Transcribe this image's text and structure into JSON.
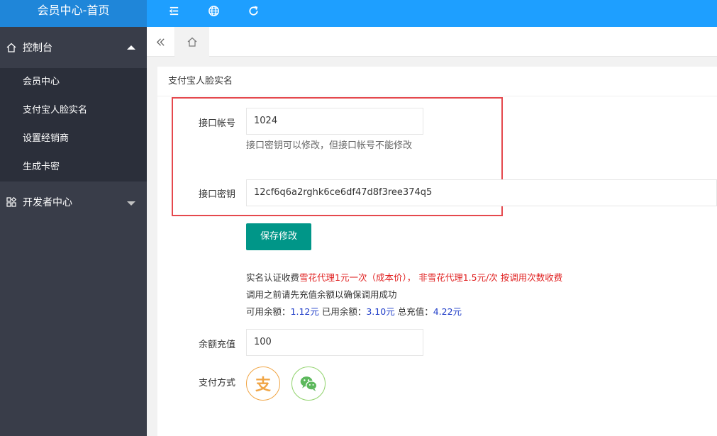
{
  "header": {
    "title": "会员中心-首页",
    "icons": [
      "menu-collapse-icon",
      "globe-icon",
      "refresh-icon"
    ]
  },
  "sidebar": {
    "console": {
      "label": "控制台",
      "icon": "home-outline-icon",
      "expanded": true
    },
    "items": [
      {
        "label": "会员中心"
      },
      {
        "label": "支付宝人脸实名"
      },
      {
        "label": "设置经销商"
      },
      {
        "label": "生成卡密"
      }
    ],
    "developer": {
      "label": "开发者中心",
      "icon": "apps-icon",
      "expanded": false
    }
  },
  "tabbar": {
    "icons": [
      "double-chevron-left-icon",
      "home-icon"
    ]
  },
  "card": {
    "title": "支付宝人脸实名",
    "account_label": "接口帐号",
    "account_value": "1024",
    "account_hint": "接口密钥可以修改，但接口帐号不能修改",
    "key_label": "接口密钥",
    "key_value": "12cf6q6a2rghk6ce6df47d8f3ree374q5",
    "save_label": "保存修改",
    "fee_prefix": "实名认证收费",
    "fee_red": "雪花代理1元一次（成本价），  非雪花代理1.5元/次 按调用次数收费",
    "notice": "调用之前请先充值余额以确保调用成功",
    "balance_label": "可用余额：",
    "balance_value": "1.12元",
    "used_label": "已用余额：",
    "used_value": "3.10元",
    "total_label": "总充值：",
    "total_value": "4.22元",
    "recharge_label": "余额充值",
    "recharge_value": "100",
    "pay_label": "支付方式",
    "pay_methods": [
      {
        "name": "alipay",
        "glyph": "支",
        "color": "#f0a545"
      },
      {
        "name": "wechat-pay",
        "color": "#5cb85c"
      }
    ]
  },
  "colors": {
    "header": "#1e9fff",
    "logo_bg": "#1f86d9",
    "sidebar": "#393d49",
    "subnav": "#2b2f3a",
    "button": "#009688",
    "highlight_box": "#e5484d",
    "fee_text": "#e02020",
    "money_text": "#1e3cc8"
  }
}
